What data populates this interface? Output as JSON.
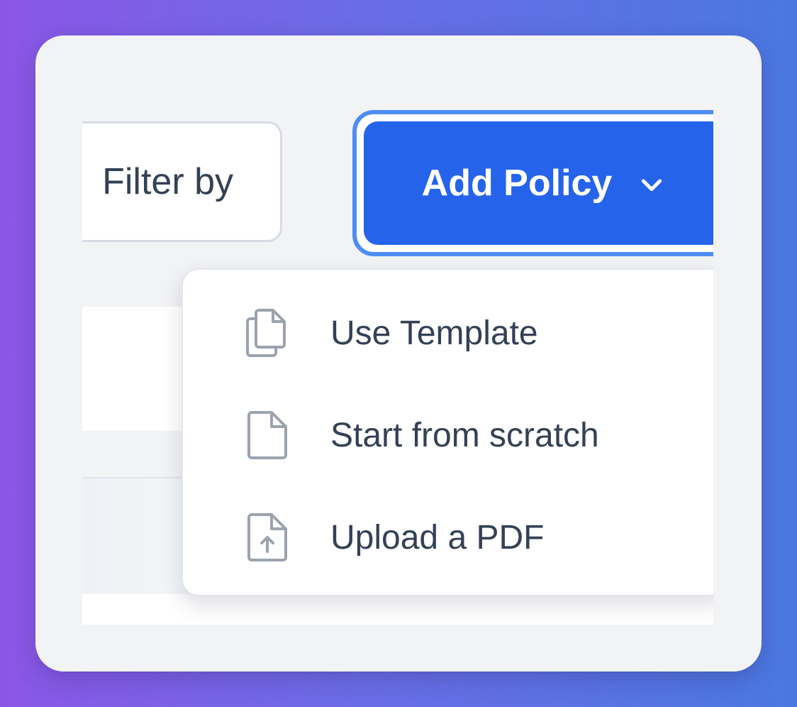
{
  "toolbar": {
    "filter_label": "Filter by",
    "add_policy_label": "Add Policy"
  },
  "menu": {
    "items": [
      {
        "label": "Use Template",
        "icon": "copy-icon"
      },
      {
        "label": "Start from scratch",
        "icon": "document-icon"
      },
      {
        "label": "Upload a PDF",
        "icon": "document-upload-icon"
      }
    ]
  },
  "colors": {
    "primary": "#2563eb",
    "focus_ring": "#4f8df5",
    "text": "#334155",
    "icon": "#9ca3af"
  }
}
